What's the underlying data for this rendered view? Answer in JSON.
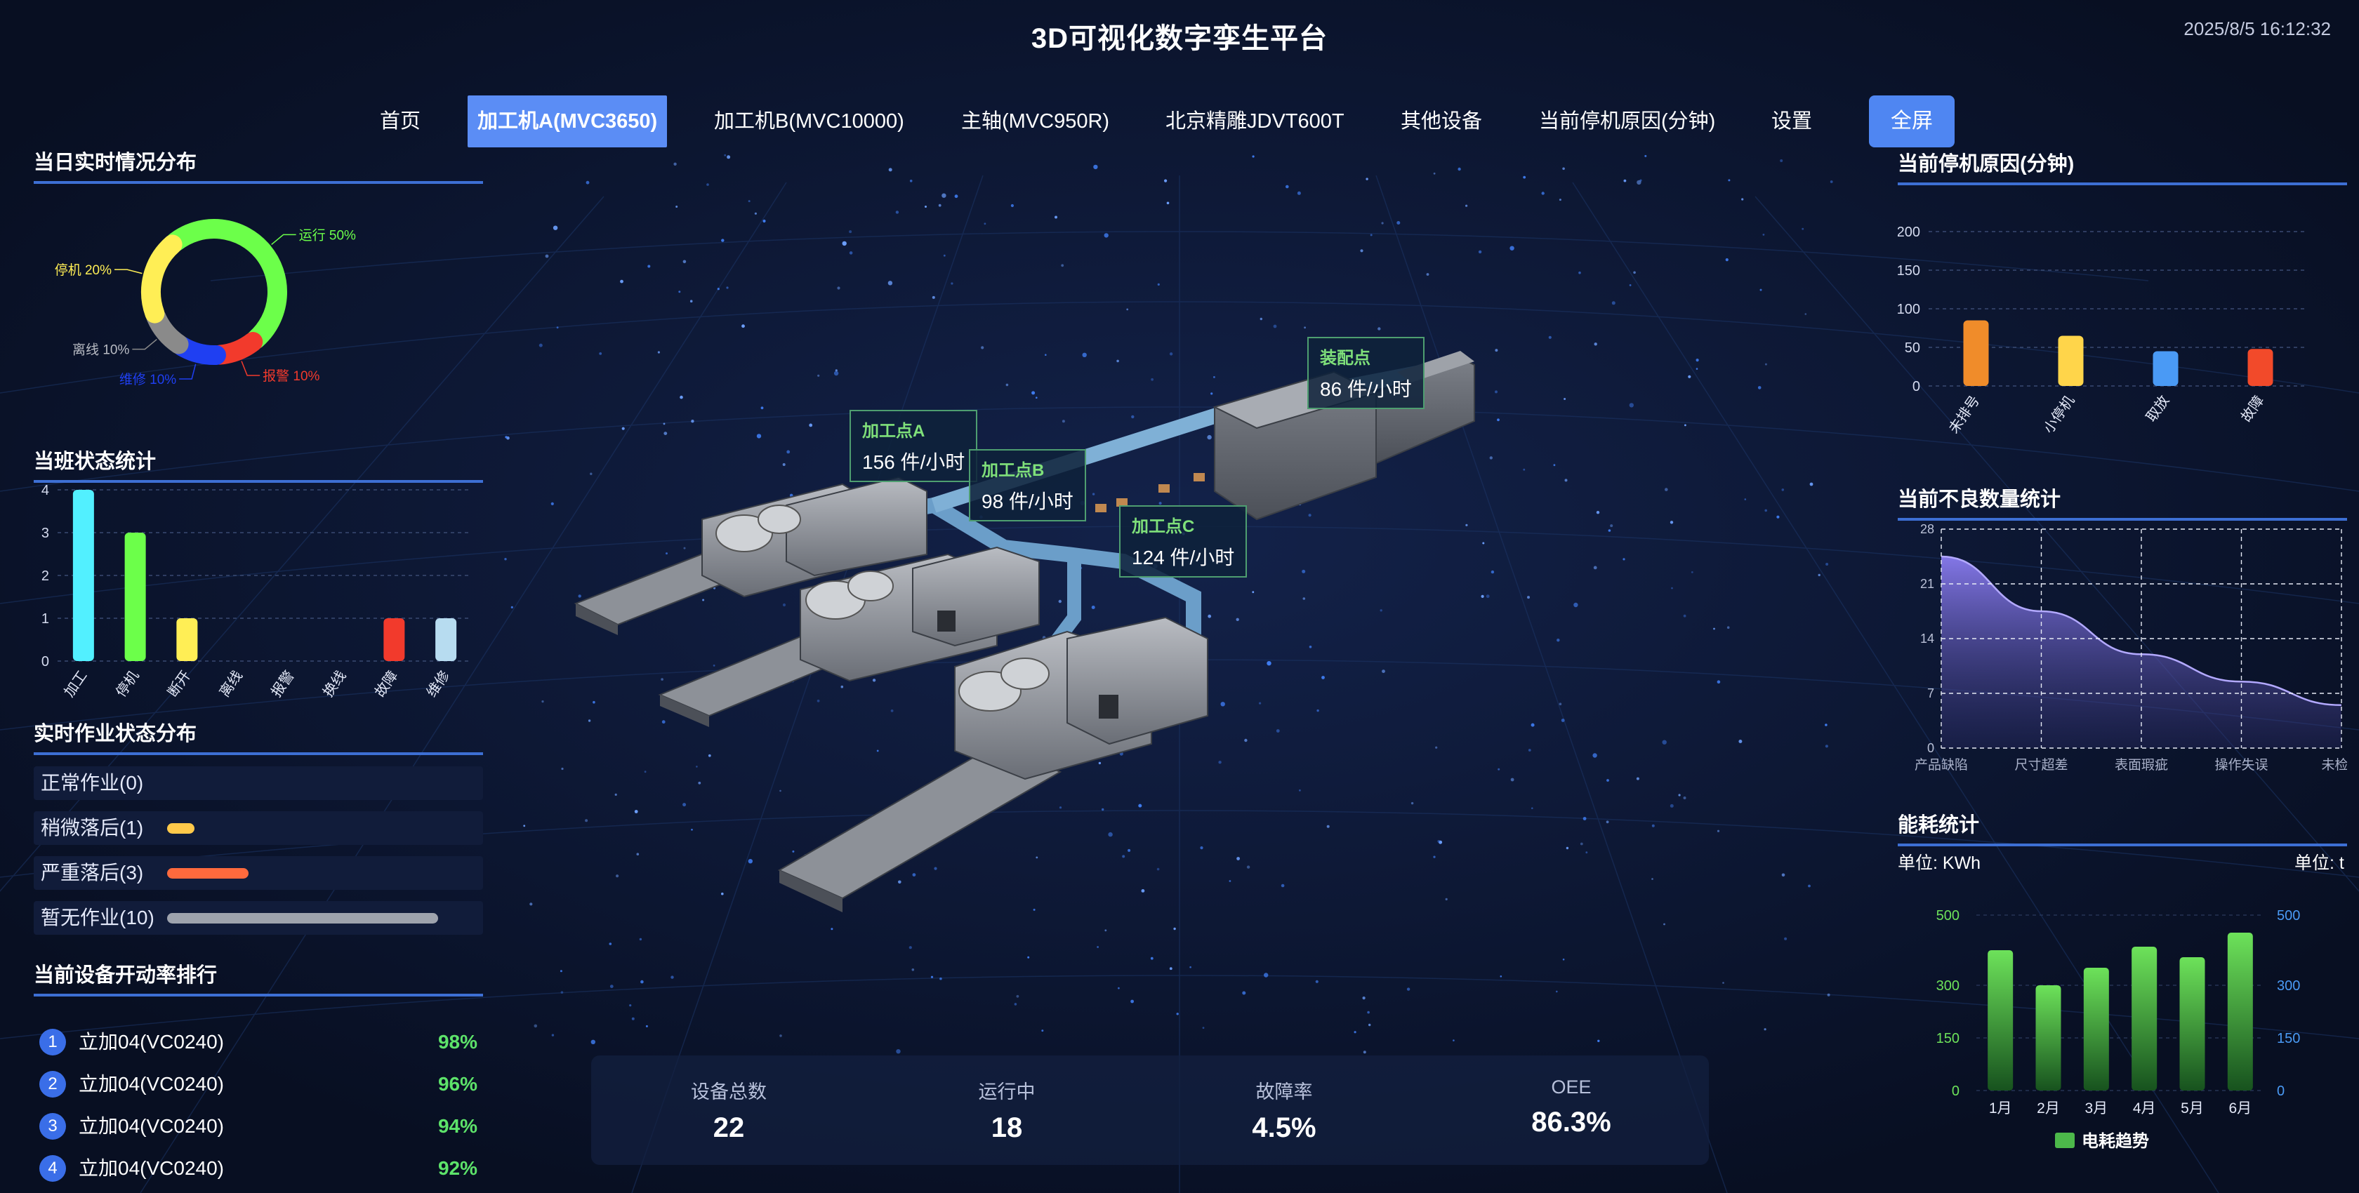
{
  "header": {
    "title": "3D可视化数字孪生平台",
    "datetime": "2025/8/5 16:12:32"
  },
  "nav": {
    "items": [
      "首页",
      "加工机A(MVC3650)",
      "加工机B(MVC10000)",
      "主轴(MVC950R)",
      "北京精雕JDVT600T",
      "其他设备",
      "当前停机原因(分钟)",
      "设置"
    ],
    "active_index": 1,
    "fullscreen_label": "全屏"
  },
  "colors": {
    "accent": "#3d6fd4",
    "run": "#6cff4a",
    "alarm": "#f23a2c",
    "repair": "#1f3ff2",
    "offline": "#8a8a8a",
    "stop": "#ffee55",
    "cyan": "#52f0ff"
  },
  "left": {
    "realtime_title": "当日实时情况分布",
    "shift_title": "当班状态统计",
    "job_title": "实时作业状态分布",
    "rate_title": "当前设备开动率排行",
    "job_status": [
      {
        "label": "正常作业(0)",
        "value": 0,
        "color": "#5fd0ff"
      },
      {
        "label": "稍微落后(1)",
        "value": 1,
        "color": "#ffc94a"
      },
      {
        "label": "严重落后(3)",
        "value": 3,
        "color": "#ff6a3d"
      },
      {
        "label": "暂无作业(10)",
        "value": 10,
        "color": "#9ea3ad"
      }
    ],
    "ranking": [
      {
        "rank": "1",
        "name": "立加04(VC0240)",
        "value": "98%"
      },
      {
        "rank": "2",
        "name": "立加04(VC0240)",
        "value": "96%"
      },
      {
        "rank": "3",
        "name": "立加04(VC0240)",
        "value": "94%"
      },
      {
        "rank": "4",
        "name": "立加04(VC0240)",
        "value": "92%"
      }
    ]
  },
  "right": {
    "downtime_title": "当前停机原因(分钟)",
    "defect_title": "当前不良数量统计",
    "energy_title": "能耗统计",
    "energy_unit_left": "单位: KWh",
    "energy_unit_right": "单位: t"
  },
  "stations": [
    {
      "name": "加工点A",
      "rate": "156 件/小时"
    },
    {
      "name": "加工点B",
      "rate": "98 件/小时"
    },
    {
      "name": "加工点C",
      "rate": "124 件/小时"
    },
    {
      "name": "装配点",
      "rate": "86 件/小时"
    }
  ],
  "stats": [
    {
      "label": "设备总数",
      "value": "22"
    },
    {
      "label": "运行中",
      "value": "18"
    },
    {
      "label": "故障率",
      "value": "4.5%"
    },
    {
      "label": "OEE",
      "value": "86.3%"
    }
  ],
  "chart_data": [
    {
      "type": "pie",
      "title": "当日实时情况分布",
      "labels": [
        "运行",
        "报警",
        "维修",
        "离线",
        "停机"
      ],
      "values": [
        50,
        10,
        10,
        10,
        20
      ],
      "colors": [
        "#6cff4a",
        "#f23a2c",
        "#1f3ff2",
        "#8a8a8a",
        "#ffee55"
      ],
      "display_labels": [
        "运行 50%",
        "报警 10%",
        "维修 10%",
        "离线 10%",
        "停机 20%"
      ]
    },
    {
      "type": "bar",
      "title": "当班状态统计",
      "categories": [
        "加工",
        "停机",
        "断开",
        "离线",
        "报警",
        "换线",
        "故障",
        "维修"
      ],
      "values": [
        4,
        3,
        1,
        0,
        0,
        0,
        1,
        1
      ],
      "colors": [
        "#52f0ff",
        "#6cff4a",
        "#ffee55",
        "#52f0ff",
        "#52f0ff",
        "#52f0ff",
        "#f23a2c",
        "#b7dcf0"
      ],
      "ylim": [
        0,
        4
      ],
      "yticks": [
        0,
        1,
        2,
        3,
        4
      ]
    },
    {
      "type": "bar",
      "title": "当前停机原因(分钟)",
      "categories": [
        "未排号",
        "小停机",
        "取放",
        "故障"
      ],
      "values": [
        85,
        65,
        45,
        48
      ],
      "colors": [
        "#f08c2a",
        "#ffd54a",
        "#4a9af5",
        "#f24a2a"
      ],
      "ylim": [
        0,
        200
      ],
      "yticks": [
        0,
        50,
        100,
        150,
        200
      ]
    },
    {
      "type": "area",
      "title": "当前不良数量统计",
      "categories": [
        "产品缺陷",
        "尺寸超差",
        "表面瑕疵",
        "操作失误",
        "未检出"
      ],
      "values": [
        24.5,
        17.5,
        12,
        8.5,
        5.5
      ],
      "ylim": [
        0,
        28
      ],
      "yticks": [
        0,
        7,
        14,
        21,
        28
      ]
    },
    {
      "type": "bar",
      "title": "能耗统计",
      "categories": [
        "1月",
        "2月",
        "3月",
        "4月",
        "5月",
        "6月"
      ],
      "series": [
        {
          "name": "电耗趋势",
          "values": [
            400,
            300,
            350,
            410,
            380,
            450
          ]
        }
      ],
      "ylim": [
        0,
        500
      ],
      "yticks": [
        0,
        150,
        300,
        500
      ],
      "y2ticks": [
        0,
        150,
        300,
        500
      ]
    }
  ]
}
